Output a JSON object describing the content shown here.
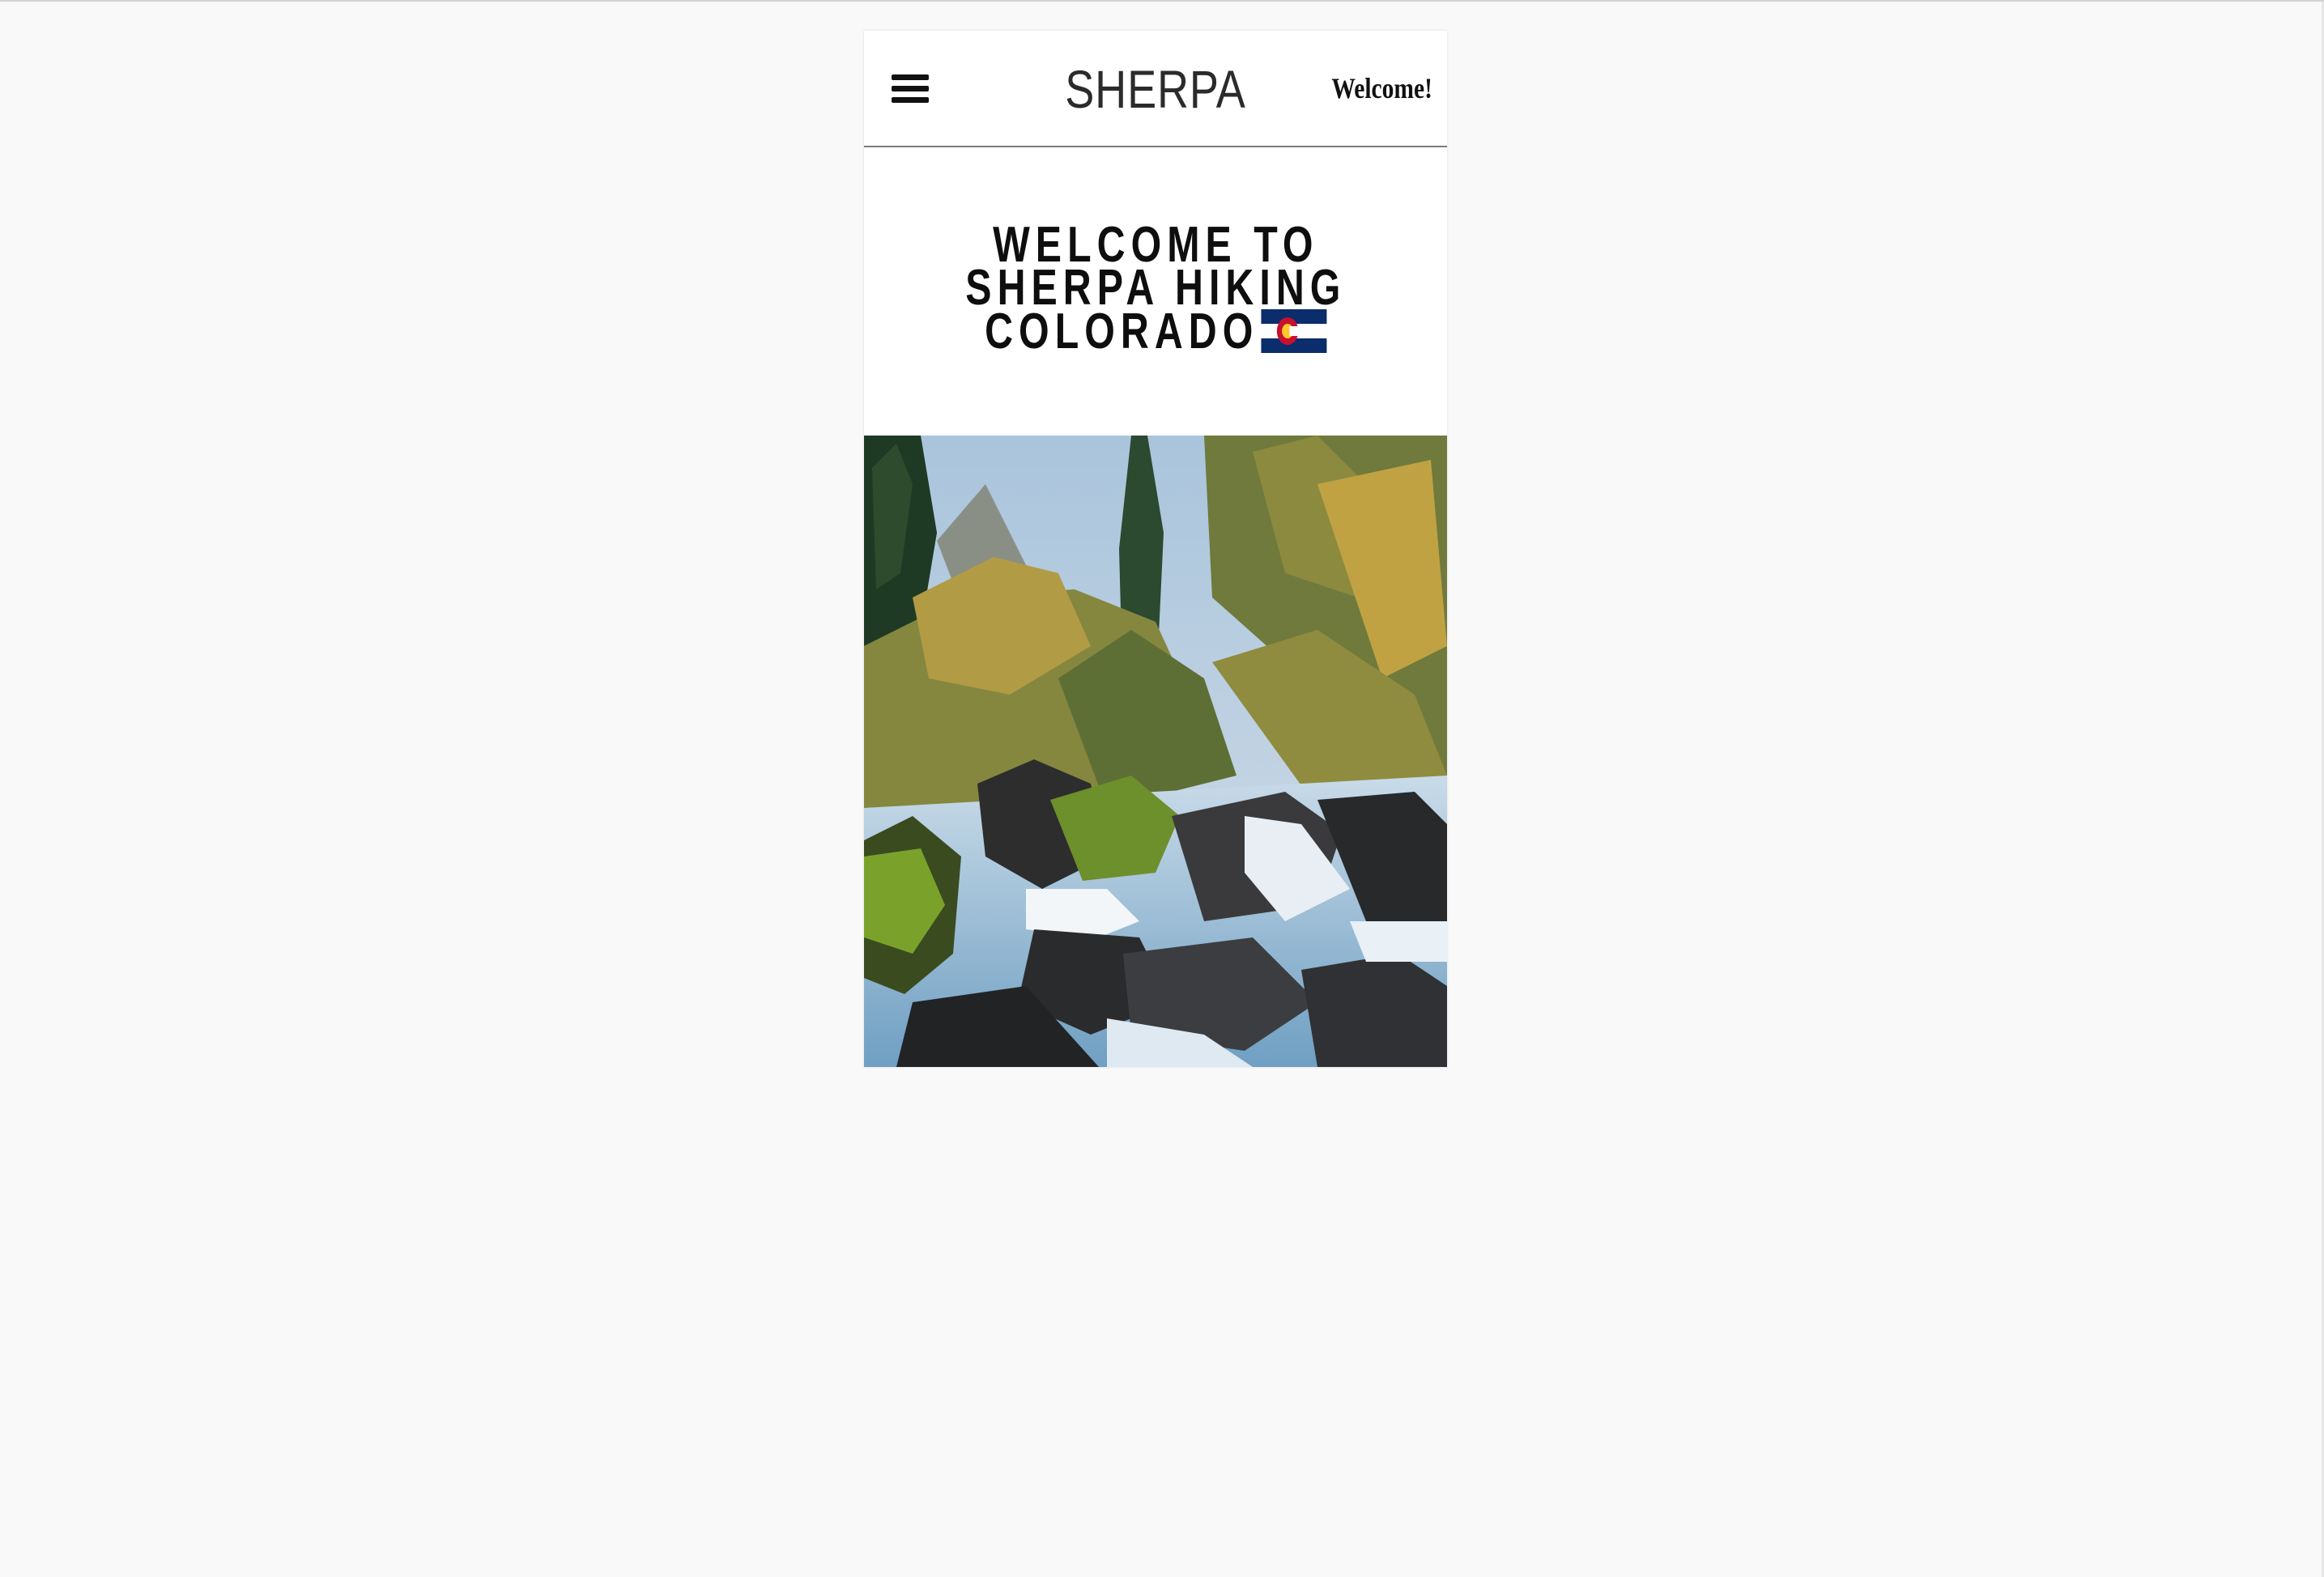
{
  "header": {
    "brand": "SHERPA",
    "welcome_link": "Welcome!",
    "menu_icon": "hamburger-menu-icon"
  },
  "hero": {
    "title_lines": [
      "WELCOME TO",
      "SHERPA HIKING",
      "COLORADO"
    ],
    "flag_icon": "colorado-flag-icon"
  },
  "image": {
    "subject": "mountain-stream-waterfall-photo"
  },
  "colors": {
    "page_background": "#f9f9f9",
    "card_background": "#ffffff",
    "title_text": "#0e0e0e",
    "flag_blue": "#0b2d6b",
    "flag_red": "#c8102e",
    "flag_gold": "#ffc72c"
  }
}
